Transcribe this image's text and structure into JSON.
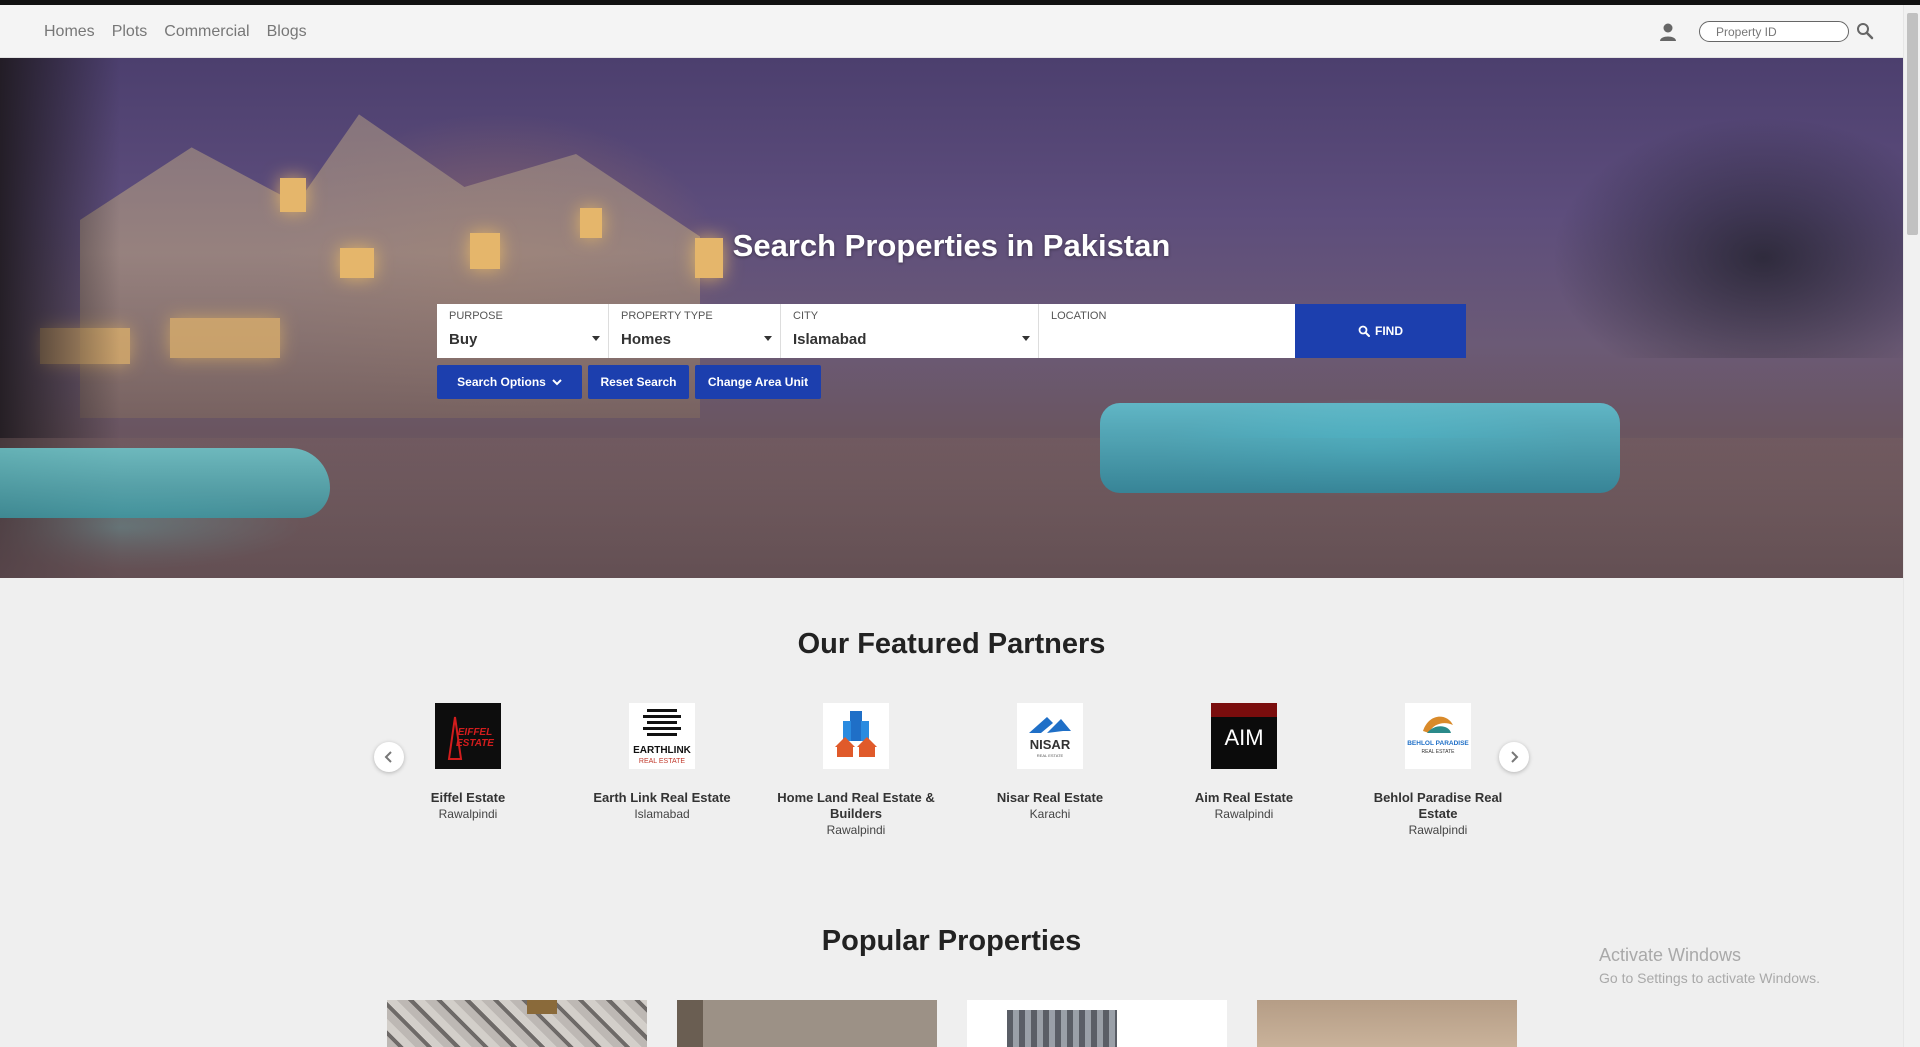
{
  "nav": {
    "links": [
      "Homes",
      "Plots",
      "Commercial",
      "Blogs"
    ],
    "property_id_placeholder": "Property ID",
    "icons": {
      "user": "user-icon",
      "search": "search-icon"
    }
  },
  "hero": {
    "title": "Search Properties in Pakistan",
    "search": {
      "purpose_label": "PURPOSE",
      "purpose_value": "Buy",
      "type_label": "PROPERTY TYPE",
      "type_value": "Homes",
      "city_label": "CITY",
      "city_value": "Islamabad",
      "location_label": "LOCATION",
      "location_value": "",
      "find_label": "FIND"
    },
    "actions": {
      "search_options": "Search Options",
      "reset_search": "Reset Search",
      "change_area_unit": "Change Area Unit"
    }
  },
  "partners": {
    "title": "Our Featured Partners",
    "items": [
      {
        "name": "Eiffel Estate",
        "city": "Rawalpindi",
        "logo_text": "EIFFEL ESTATE"
      },
      {
        "name": "Earth Link Real Estate",
        "city": "Islamabad",
        "logo_text": "EARTHLINK",
        "logo_sub": "REAL ESTATE"
      },
      {
        "name": "Home Land Real Estate & Builders",
        "city": "Rawalpindi"
      },
      {
        "name": "Nisar Real Estate",
        "city": "Karachi",
        "logo_text": "NISAR"
      },
      {
        "name": "Aim Real Estate",
        "city": "Rawalpindi",
        "logo_text": "AIM"
      },
      {
        "name": "Behlol Paradise Real Estate",
        "city": "Rawalpindi",
        "logo_text": "BEHLOL PARADISE",
        "logo_sub": "REAL ESTATE"
      }
    ]
  },
  "popular": {
    "title": "Popular Properties"
  },
  "watermark": {
    "line1": "Activate Windows",
    "line2": "Go to Settings to activate Windows."
  },
  "colors": {
    "accent": "#1c3fae",
    "background": "#efefef"
  }
}
